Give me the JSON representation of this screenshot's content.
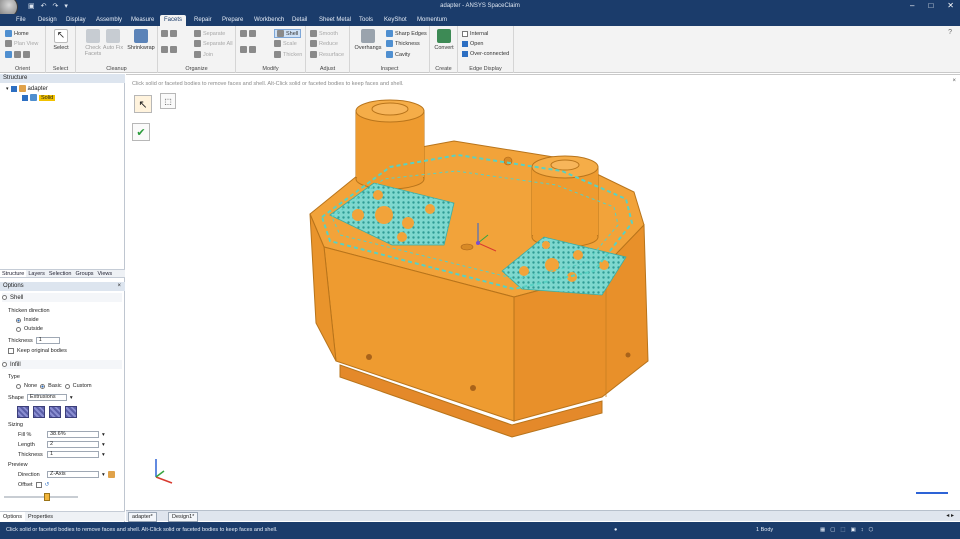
{
  "app": {
    "title": "adapter - ANSYS SpaceClaim",
    "window_controls": [
      "–",
      "□",
      "✕"
    ]
  },
  "quick_access": [
    "▣",
    "↶",
    "↷",
    "▾"
  ],
  "tabs": [
    "File",
    "Design",
    "Display",
    "Assembly",
    "Measure",
    "Facets",
    "Repair",
    "Prepare",
    "Workbench",
    "Detail",
    "Sheet Metal",
    "Tools",
    "KeyShot",
    "Momentum"
  ],
  "active_tab": "Facets",
  "ribbon": {
    "orient": {
      "name": "Orient",
      "home": "Home",
      "plan_view": "Plan View"
    },
    "select": {
      "name": "Select",
      "label": "Select"
    },
    "cleanup": {
      "name": "Cleanup",
      "check_facets": "Check Facets",
      "auto_fix": "Auto Fix",
      "shrinkwrap": "Shrinkwrap"
    },
    "organize": {
      "name": "Organize",
      "separate": "Separate",
      "separate_all": "Separate All",
      "join": "Join"
    },
    "modify": {
      "name": "Modify",
      "shell": "Shell",
      "scale": "Scale",
      "thicken": "Thicken"
    },
    "adjust": {
      "name": "Adjust",
      "smooth": "Smooth",
      "reduce": "Reduce",
      "resurface": "Resurface"
    },
    "inspect": {
      "name": "Inspect",
      "overhangs": "Overhangs",
      "sharp_edges": "Sharp Edges",
      "thickness": "Thickness",
      "cavity": "Cavity"
    },
    "create": {
      "name": "Create",
      "convert": "Convert"
    },
    "edge_display": {
      "name": "Edge Display",
      "internal": "Internal",
      "open": "Open",
      "over_connected": "Over-connected"
    }
  },
  "structure": {
    "header": "Structure",
    "root": "adapter",
    "child": "Solid"
  },
  "panel_tabs": [
    "Structure",
    "Layers",
    "Selection",
    "Groups",
    "Views"
  ],
  "options": {
    "header": "Options",
    "shell_section": "Shell",
    "thicken_direction": "Thicken direction",
    "inside": "Inside",
    "outside": "Outside",
    "thickness_label": "Thickness",
    "thickness_value": "1",
    "keep_original": "Keep original bodies",
    "infill_section": "Infill",
    "type_label": "Type",
    "type_none": "None",
    "type_basic": "Basic",
    "type_custom": "Custom",
    "shape_label": "Shape",
    "shape_value": "Extrusions",
    "sizing_label": "Sizing",
    "fill_label": "Fill %",
    "fill_value": "38.6%",
    "length_label": "Length",
    "length_value": "2",
    "thickness2_label": "Thickness",
    "thickness2_value": "1",
    "preview_label": "Preview",
    "direction_label": "Direction",
    "direction_value": "Z-Axis",
    "offset_label": "Offset"
  },
  "bottom_panel_tabs": [
    "Options",
    "Properties"
  ],
  "viewport": {
    "hint": "Click solid or faceted bodies to remove faces and shell. Alt-Click solid or faceted bodies to keep faces and shell."
  },
  "doc_tabs": [
    "adapter*",
    "Design1*"
  ],
  "status": {
    "message": "Click solid or faceted bodies to remove faces and shell. Alt-Click solid or faceted bodies to keep faces and shell.",
    "selection": "1 Body"
  },
  "colors": {
    "chrome": "#1b3c6b",
    "part": "#f09a2a",
    "lattice": "#69d2c6"
  }
}
